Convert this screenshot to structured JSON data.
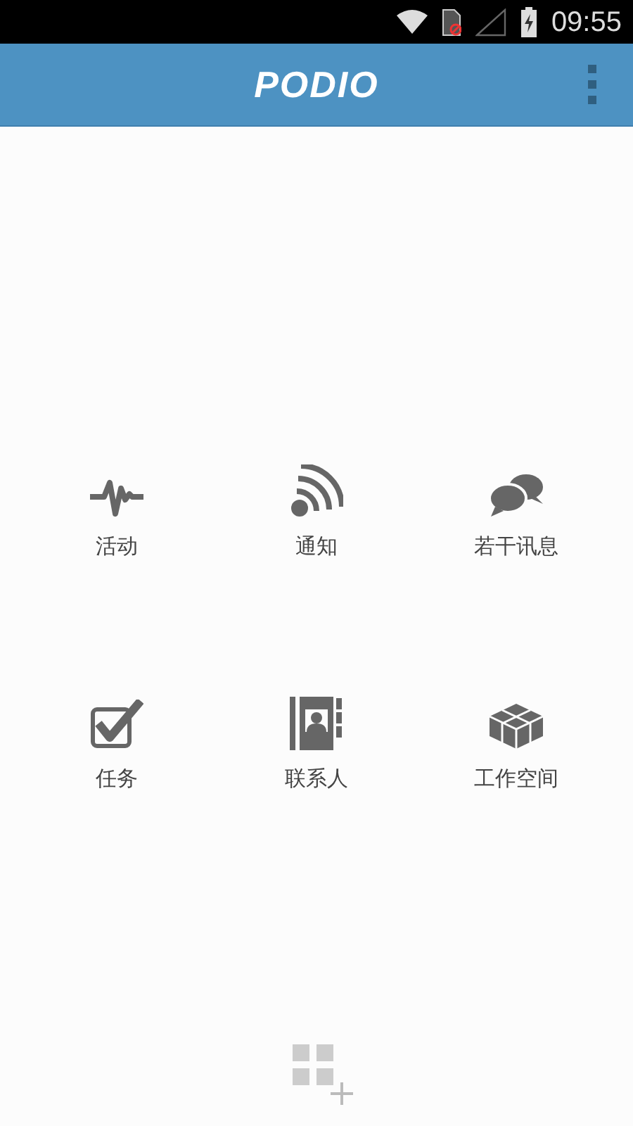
{
  "status_bar": {
    "time": "09:55"
  },
  "header": {
    "logo": "PODIO"
  },
  "items": [
    {
      "kind": "activity",
      "label": "活动"
    },
    {
      "kind": "notifications",
      "label": "通知"
    },
    {
      "kind": "messages",
      "label": "若干讯息"
    },
    {
      "kind": "tasks",
      "label": "任务"
    },
    {
      "kind": "contacts",
      "label": "联系人"
    },
    {
      "kind": "workspaces",
      "label": "工作空间"
    }
  ]
}
